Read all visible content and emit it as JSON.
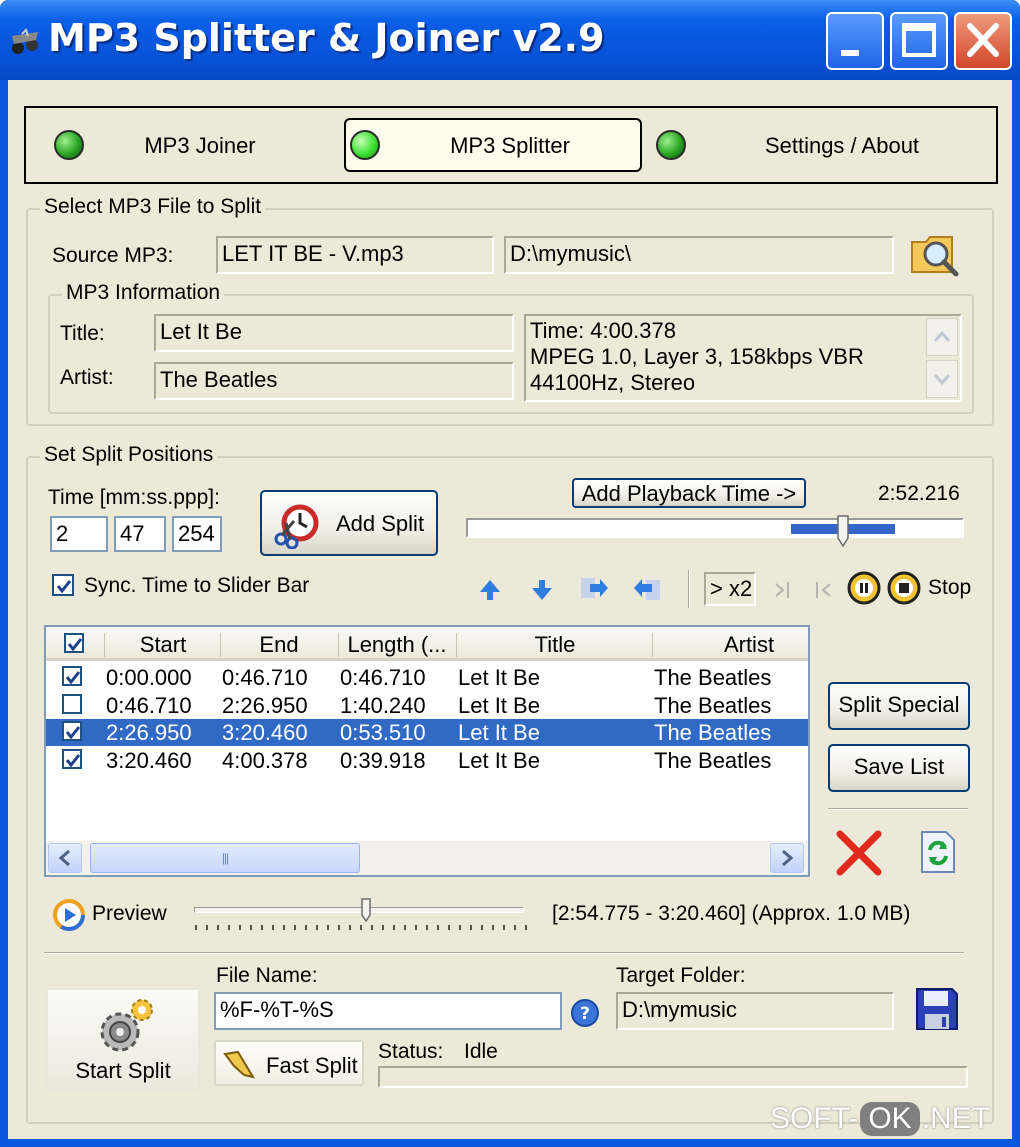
{
  "window": {
    "title": "MP3 Splitter & Joiner v2.9"
  },
  "tabs": [
    {
      "label": "MP3 Joiner",
      "active": false
    },
    {
      "label": "MP3 Splitter",
      "active": true
    },
    {
      "label": "Settings / About",
      "active": false
    }
  ],
  "select_file": {
    "group_label": "Select MP3 File to Split",
    "source_label": "Source MP3:",
    "file_name": "LET IT BE - V.mp3",
    "folder": "D:\\mymusic\\",
    "info": {
      "group_label": "MP3 Information",
      "title_label": "Title:",
      "title": "Let It Be",
      "artist_label": "Artist:",
      "artist": "The Beatles",
      "details": [
        "Time: 4:00.378",
        "MPEG 1.0, Layer 3, 158kbps VBR",
        "44100Hz, Stereo"
      ]
    }
  },
  "split": {
    "group_label": "Set Split Positions",
    "time_label": "Time [mm:ss.ppp]:",
    "time_min": "2",
    "time_sec": "47",
    "time_ms": "254",
    "add_split_label": "Add Split",
    "add_playback_label": "Add Playback Time ->",
    "playback_time": "2:52.216",
    "playback_position": 0.76,
    "sync_label": "Sync. Time to Slider Bar",
    "sync_checked": true,
    "speed_label": "> x2",
    "stop_label": "Stop"
  },
  "table": {
    "columns": [
      "Start",
      "End",
      "Length (...",
      "Title",
      "Artist"
    ],
    "rows": [
      {
        "checked": true,
        "start": "0:00.000",
        "end": "0:46.710",
        "length": "0:46.710",
        "title": "Let It Be",
        "artist": "The Beatles",
        "selected": false
      },
      {
        "checked": false,
        "start": "0:46.710",
        "end": "2:26.950",
        "length": "1:40.240",
        "title": "Let It Be",
        "artist": "The Beatles",
        "selected": false
      },
      {
        "checked": true,
        "start": "2:26.950",
        "end": "3:20.460",
        "length": "0:53.510",
        "title": "Let It Be",
        "artist": "The Beatles",
        "selected": true
      },
      {
        "checked": true,
        "start": "3:20.460",
        "end": "4:00.378",
        "length": "0:39.918",
        "title": "Let It Be",
        "artist": "The Beatles",
        "selected": false
      }
    ],
    "split_special_label": "Split Special",
    "save_list_label": "Save List"
  },
  "preview": {
    "label": "Preview",
    "position": 0.52,
    "range_text": "[2:54.775 - 3:20.460] (Approx. 1.0 MB)"
  },
  "output": {
    "start_split_label": "Start Split",
    "file_name_label": "File Name:",
    "file_name_pattern": "%F-%T-%S",
    "target_folder_label": "Target Folder:",
    "target_folder": "D:\\mymusic",
    "fast_split_label": "Fast Split",
    "status_label": "Status:",
    "status_value": "Idle"
  },
  "watermark": {
    "left": "SOFT-",
    "mid": "OK",
    "right": ".NET"
  }
}
